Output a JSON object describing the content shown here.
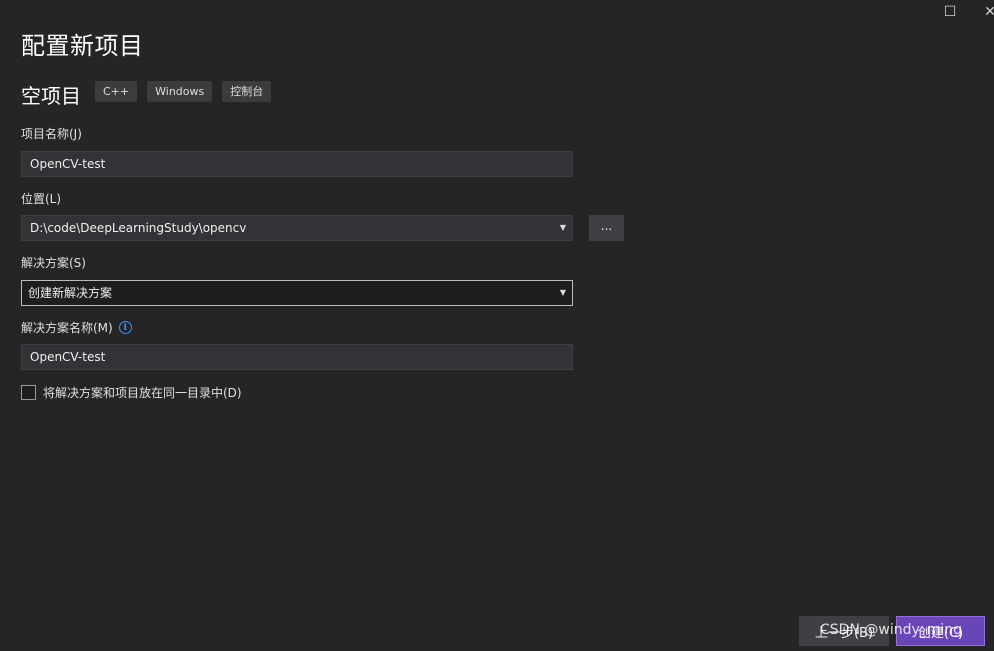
{
  "window": {
    "maximize_glyph": "☐",
    "close_glyph": "✕"
  },
  "page_title": "配置新项目",
  "template": {
    "name": "空项目",
    "tags": [
      "C++",
      "Windows",
      "控制台"
    ]
  },
  "project_name": {
    "label": "项目名称(J)",
    "value": "OpenCV-test"
  },
  "location": {
    "label": "位置(L)",
    "value": "D:\\code\\DeepLearningStudy\\opencv",
    "browse_label": "..."
  },
  "solution": {
    "label": "解决方案(S)",
    "value": "创建新解决方案"
  },
  "solution_name": {
    "label": "解决方案名称(M)",
    "info_glyph": "i",
    "value": "OpenCV-test"
  },
  "same_directory": {
    "label": "将解决方案和项目放在同一目录中(D)",
    "checked": false
  },
  "footer": {
    "back_label": "上一步(B)",
    "create_label": "创建(C)",
    "watermark": "CSDN @windy_ming"
  },
  "colors": {
    "background": "#252526",
    "field_bg": "#333337",
    "accent": "#6a45b8",
    "info": "#3794ff"
  },
  "icons": {
    "maximize": "maximize-icon",
    "close": "close-icon",
    "info": "info-icon",
    "dropdown": "chevron-down-icon"
  }
}
